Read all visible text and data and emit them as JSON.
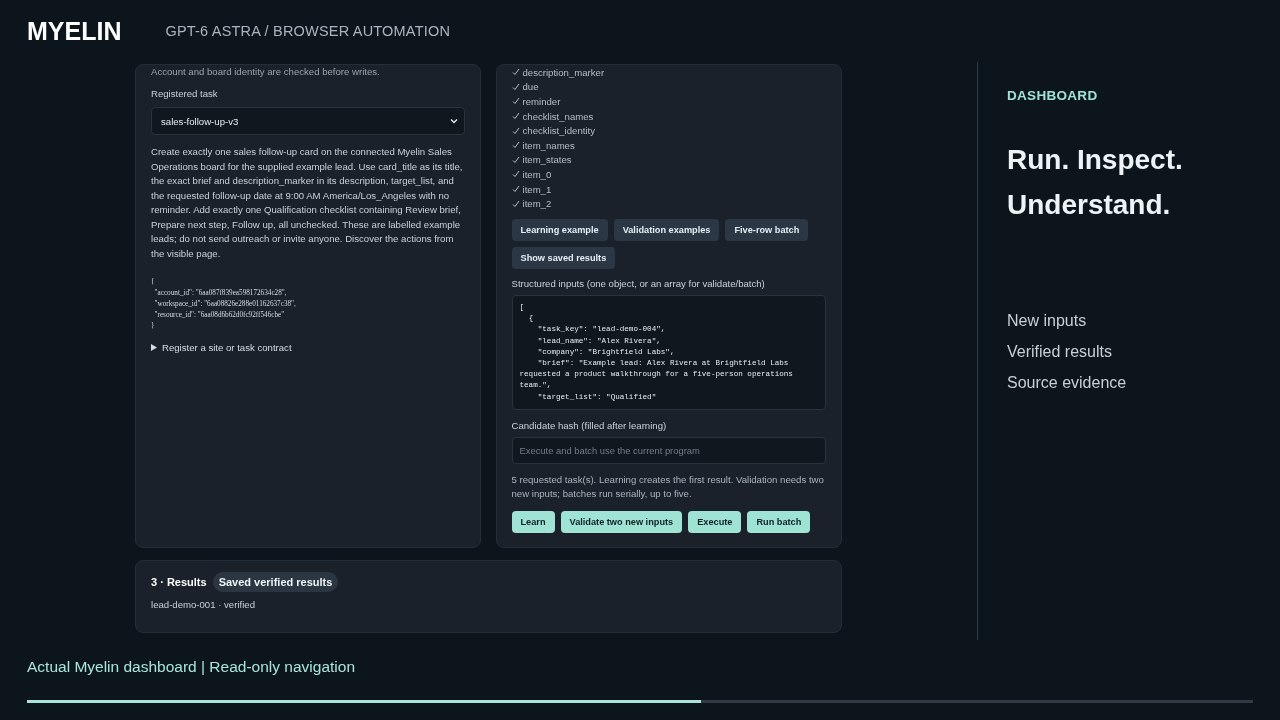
{
  "header": {
    "logo": "MYELIN",
    "breadcrumb": "GPT-6 ASTRA / BROWSER AUTOMATION"
  },
  "task_panel": {
    "note": "Account and board identity are checked before writes.",
    "select_label": "Registered task",
    "select_value": "sales-follow-up-v3",
    "description": "Create exactly one sales follow-up card on the connected Myelin Sales Operations board for the supplied example lead. Use card_title as its title, the exact brief and description_marker in its description, target_list, and the requested follow-up date at 9:00 AM America/Los_Angeles with no reminder. Add exactly one Qualification checklist containing Review brief, Prepare next step, Follow up, all unchecked. These are labelled example leads; do not send outreach or invite anyone. Discover the actions from the visible page.",
    "ids_json": "{\n  \"account_id\": \"6aa087f839ea598172634c28\",\n  \"workspace_id\": \"6aa08826e288e01162637c38\",\n  \"resource_id\": \"6aa08d6b62d0fc92ff546cbe\"\n}",
    "disclosure": {
      "label": "Register a site or task contract",
      "expanded": false
    }
  },
  "checks_panel": {
    "checks": [
      {
        "label": "description_marker",
        "checked": true
      },
      {
        "label": "due",
        "checked": true
      },
      {
        "label": "reminder",
        "checked": true
      },
      {
        "label": "checklist_names",
        "checked": true
      },
      {
        "label": "checklist_identity",
        "checked": true
      },
      {
        "label": "item_names",
        "checked": true
      },
      {
        "label": "item_states",
        "checked": true
      },
      {
        "label": "item_0",
        "checked": true
      },
      {
        "label": "item_1",
        "checked": true
      },
      {
        "label": "item_2",
        "checked": true
      }
    ],
    "example_buttons": [
      "Learning example",
      "Validation examples",
      "Five-row batch",
      "Show saved results"
    ],
    "inputs_label": "Structured inputs (one object, or an array for validate/batch)",
    "inputs_value": "[\n  {\n    \"task_key\": \"lead-demo-004\",\n    \"lead_name\": \"Alex Rivera\",\n    \"company\": \"Brightfield Labs\",\n    \"brief\": \"Example lead: Alex Rivera at Brightfield Labs requested a product walkthrough for a five-person operations team.\",\n    \"target_list\": \"Qualified\"",
    "hash_label": "Candidate hash (filled after learning)",
    "hash_placeholder": "Execute and batch use the current program",
    "info": "5 requested task(s). Learning creates the first result. Validation needs two new inputs; batches run serially, up to five.",
    "action_buttons": [
      "Learn",
      "Validate two new inputs",
      "Execute",
      "Run batch"
    ]
  },
  "results": {
    "title": "3 · Results",
    "badge": "Saved verified results",
    "first_row": "lead-demo-001 · verified"
  },
  "sidebar": {
    "section": "DASHBOARD",
    "headline": [
      "Run. Inspect.",
      "Understand."
    ],
    "links": [
      "New inputs",
      "Verified results",
      "Source evidence"
    ]
  },
  "footer": {
    "caption": "Actual Myelin dashboard | Read-only navigation",
    "progress": {
      "level": 0.55
    }
  }
}
